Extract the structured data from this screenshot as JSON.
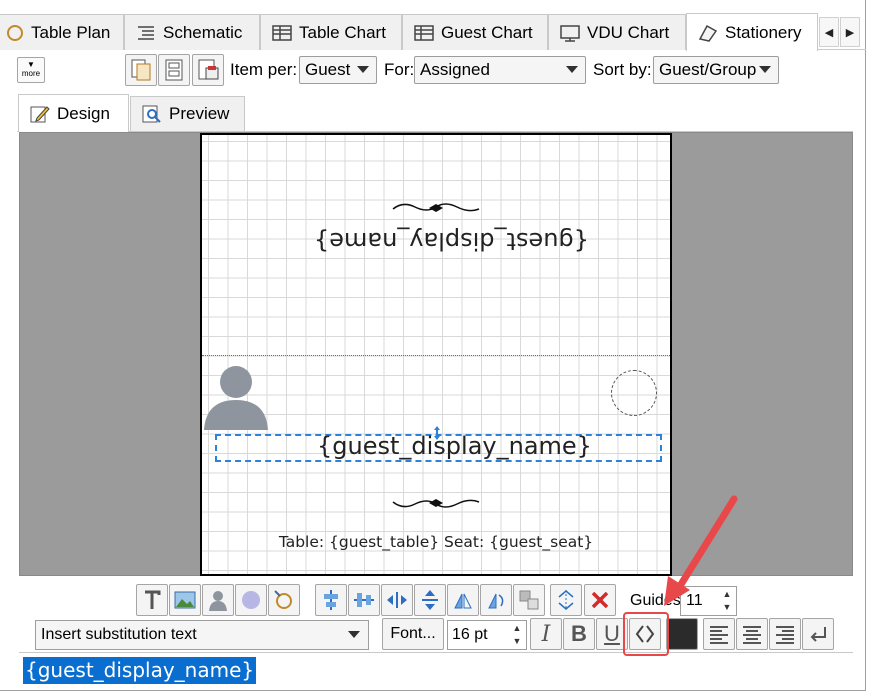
{
  "main_tabs": [
    {
      "label": "Table Plan",
      "icon": "table-plan-icon"
    },
    {
      "label": "Schematic",
      "icon": "schematic-icon"
    },
    {
      "label": "Table Chart",
      "icon": "table-chart-icon"
    },
    {
      "label": "Guest Chart",
      "icon": "guest-chart-icon"
    },
    {
      "label": "VDU Chart",
      "icon": "monitor-icon"
    },
    {
      "label": "Stationery",
      "icon": "stationery-icon",
      "active": true
    }
  ],
  "toolbar": {
    "more_label": "more",
    "item_per_label": "Item per:",
    "item_per_value": "Guest",
    "for_label": "For:",
    "for_value": "Assigned",
    "sort_by_label": "Sort by:",
    "sort_by_value": "Guest/Group"
  },
  "view_tabs": [
    {
      "label": "Design",
      "icon": "design-icon",
      "active": true
    },
    {
      "label": "Preview",
      "icon": "preview-icon"
    }
  ],
  "canvas": {
    "top_name": "{guest_display_name}",
    "bottom_name": "{guest_display_name}",
    "seat_line": "Table: {guest_table} Seat: {guest_seat}"
  },
  "design_toolbar": {
    "guides_label": "Guides:",
    "guides_value": "11"
  },
  "format_toolbar": {
    "substitution_placeholder": "Insert substitution text",
    "font_button": "Font...",
    "font_size": "16 pt"
  },
  "editor": {
    "selected_text": "{guest_display_name}"
  },
  "colors": {
    "accent": "#0a6ed1",
    "selection_border": "#2e82d6",
    "callout": "#e8484a",
    "canvas_bg": "#9b9b9b"
  }
}
